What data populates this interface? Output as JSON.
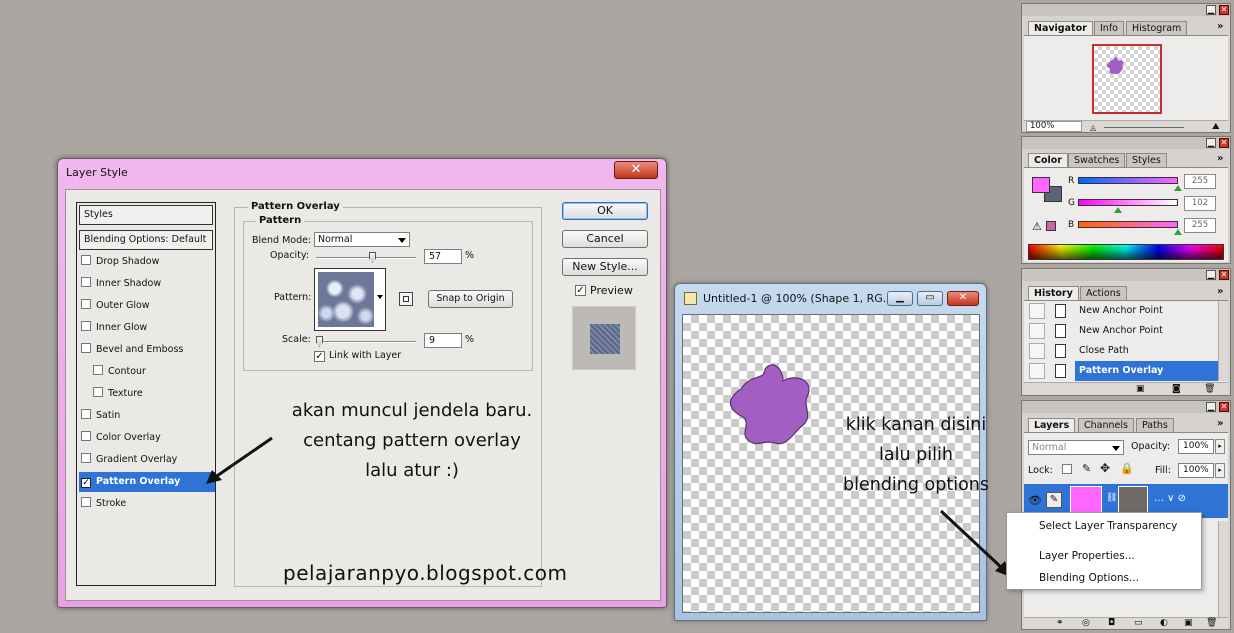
{
  "layer_style": {
    "title": "Layer Style",
    "close_glyph": "✕",
    "styles_header": "Styles",
    "blending_header": "Blending Options: Default",
    "items": [
      {
        "label": "Drop Shadow",
        "checked": false
      },
      {
        "label": "Inner Shadow",
        "checked": false
      },
      {
        "label": "Outer Glow",
        "checked": false
      },
      {
        "label": "Inner Glow",
        "checked": false
      },
      {
        "label": "Bevel and Emboss",
        "checked": false
      },
      {
        "label": "Contour",
        "checked": false
      },
      {
        "label": "Texture",
        "checked": false
      },
      {
        "label": "Satin",
        "checked": false
      },
      {
        "label": "Color Overlay",
        "checked": false
      },
      {
        "label": "Gradient Overlay",
        "checked": false
      },
      {
        "label": "Pattern Overlay",
        "checked": true
      },
      {
        "label": "Stroke",
        "checked": false
      }
    ],
    "section_title": "Pattern Overlay",
    "group_title": "Pattern",
    "blend_mode_label": "Blend Mode:",
    "blend_mode_value": "Normal",
    "opacity_label": "Opacity:",
    "opacity_value": "57",
    "percent": "%",
    "pattern_label": "Pattern:",
    "snap_button": "Snap to Origin",
    "scale_label": "Scale:",
    "scale_value": "9",
    "link_label": "Link with Layer",
    "ok_button": "OK",
    "cancel_button": "Cancel",
    "new_style_button": "New Style...",
    "preview_label": "Preview"
  },
  "annotations": {
    "left_note": "akan muncul jendela baru.\ncentang pattern overlay\nlalu atur :)",
    "right_note": "klik kanan disini\nlalu pilih\nblending options",
    "watermark": "pelajaranpyo.blogspot.com"
  },
  "document": {
    "title": "Untitled-1 @ 100% (Shape 1, RG...",
    "shape_color": "#a35ec4"
  },
  "navigator": {
    "tabs": [
      "Navigator",
      "Info",
      "Histogram"
    ],
    "zoom": "100%"
  },
  "color_panel": {
    "tabs": [
      "Color",
      "Swatches",
      "Styles"
    ],
    "channels": [
      {
        "label": "R",
        "value": "255"
      },
      {
        "label": "G",
        "value": "102"
      },
      {
        "label": "B",
        "value": "255"
      }
    ],
    "foreground": "#ff66ff"
  },
  "history": {
    "tabs": [
      "History",
      "Actions"
    ],
    "items": [
      "New Anchor Point",
      "New Anchor Point",
      "Close Path",
      "Pattern Overlay"
    ]
  },
  "layers": {
    "tabs": [
      "Layers",
      "Channels",
      "Paths"
    ],
    "blend_mode": "Normal",
    "opacity_label": "Opacity:",
    "opacity_value": "100%",
    "lock_label": "Lock:",
    "fill_label": "Fill:",
    "fill_value": "100%",
    "context_menu": [
      "Select Layer Transparency",
      "Layer Properties...",
      "Blending Options..."
    ]
  }
}
